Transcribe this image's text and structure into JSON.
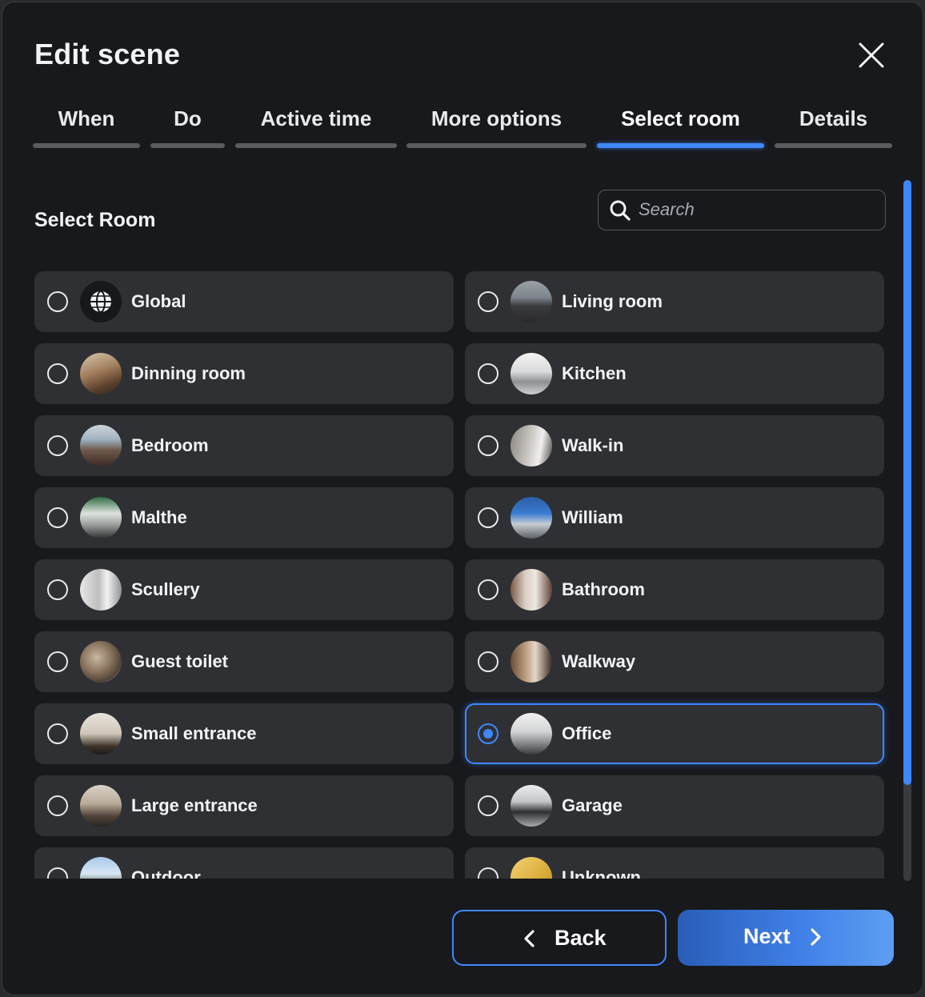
{
  "dialog": {
    "title": "Edit scene"
  },
  "tabs": [
    {
      "label": "When"
    },
    {
      "label": "Do"
    },
    {
      "label": "Active time"
    },
    {
      "label": "More options"
    },
    {
      "label": "Select room",
      "active": true
    },
    {
      "label": "Details"
    }
  ],
  "section": {
    "title": "Select Room"
  },
  "search": {
    "placeholder": "Search",
    "value": ""
  },
  "rooms": [
    {
      "label": "Global",
      "selected": false
    },
    {
      "label": "Living room",
      "selected": false
    },
    {
      "label": "Dinning room",
      "selected": false
    },
    {
      "label": "Kitchen",
      "selected": false
    },
    {
      "label": "Bedroom",
      "selected": false
    },
    {
      "label": "Walk-in",
      "selected": false
    },
    {
      "label": "Malthe",
      "selected": false
    },
    {
      "label": "William",
      "selected": false
    },
    {
      "label": "Scullery",
      "selected": false
    },
    {
      "label": "Bathroom",
      "selected": false
    },
    {
      "label": "Guest toilet",
      "selected": false
    },
    {
      "label": "Walkway",
      "selected": false
    },
    {
      "label": "Small entrance",
      "selected": false
    },
    {
      "label": "Office",
      "selected": true
    },
    {
      "label": "Large entrance",
      "selected": false
    },
    {
      "label": "Garage",
      "selected": false
    },
    {
      "label": "Outdoor",
      "selected": false
    },
    {
      "label": "Unknown",
      "selected": false
    }
  ],
  "footer": {
    "back_label": "Back",
    "next_label": "Next"
  },
  "colors": {
    "accent": "#3f87ff",
    "background": "#18191c",
    "card": "#2f3033"
  }
}
